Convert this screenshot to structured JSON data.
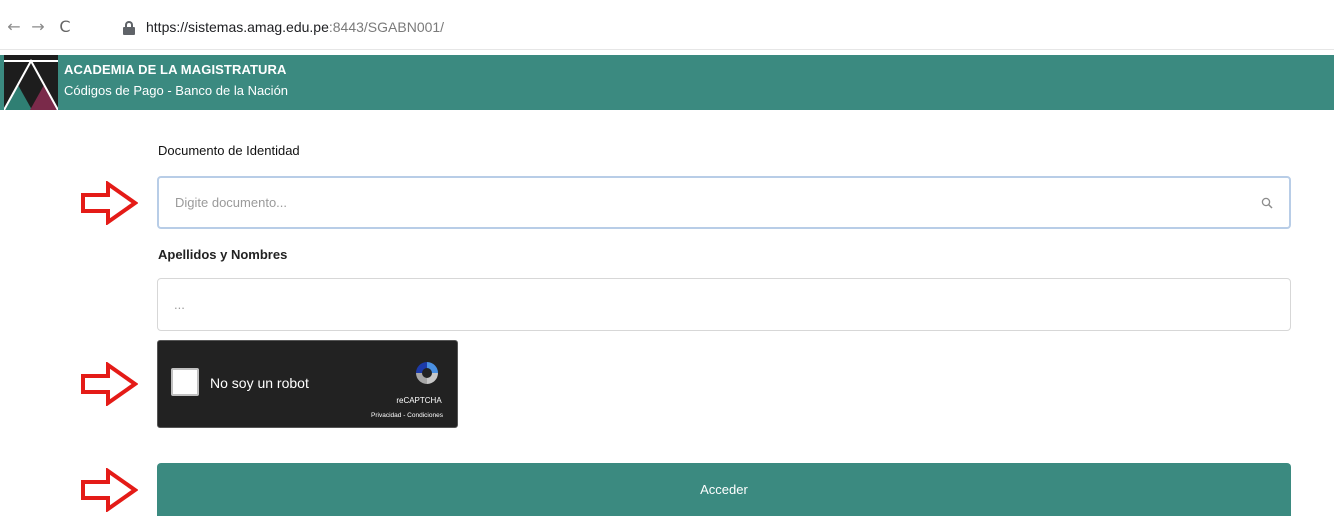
{
  "browser": {
    "url_host": "https://sistemas.amag.edu.pe",
    "url_rest": ":8443/SGABN001/",
    "back_icon": "arrow-left-icon",
    "forward_icon": "arrow-right-icon",
    "reload_icon": "reload-icon",
    "lock_icon": "lock-icon"
  },
  "header": {
    "title": "ACADEMIA DE LA MAGISTRATURA",
    "subtitle": "Códigos de Pago - Banco de la Nación",
    "background_color": "#3b8a80"
  },
  "form": {
    "document_label": "Documento de Identidad",
    "document_placeholder": "Digite documento...",
    "document_value": "",
    "names_label": "Apellidos y Nombres",
    "names_placeholder": "...",
    "names_value": ""
  },
  "captcha": {
    "label": "No soy un robot",
    "brand": "reCAPTCHA",
    "links": "Privacidad - Condiciones",
    "checked": false
  },
  "submit": {
    "label": "Acceder",
    "color": "#3b8a80"
  },
  "annotation_color": "#e41b17"
}
